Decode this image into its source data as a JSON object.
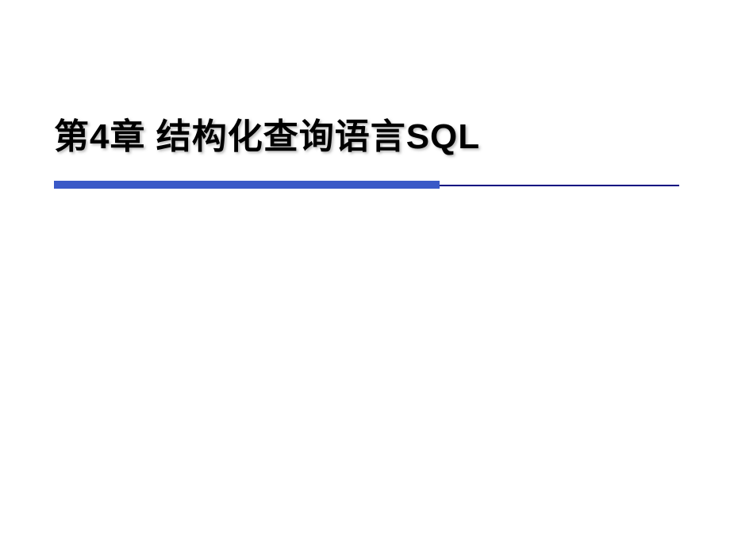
{
  "slide": {
    "title": "第4章  结构化查询语言SQL"
  },
  "theme": {
    "accent_thick": "#3a59c7",
    "accent_thin": "#000080",
    "text_color": "#000000",
    "background": "#ffffff"
  }
}
